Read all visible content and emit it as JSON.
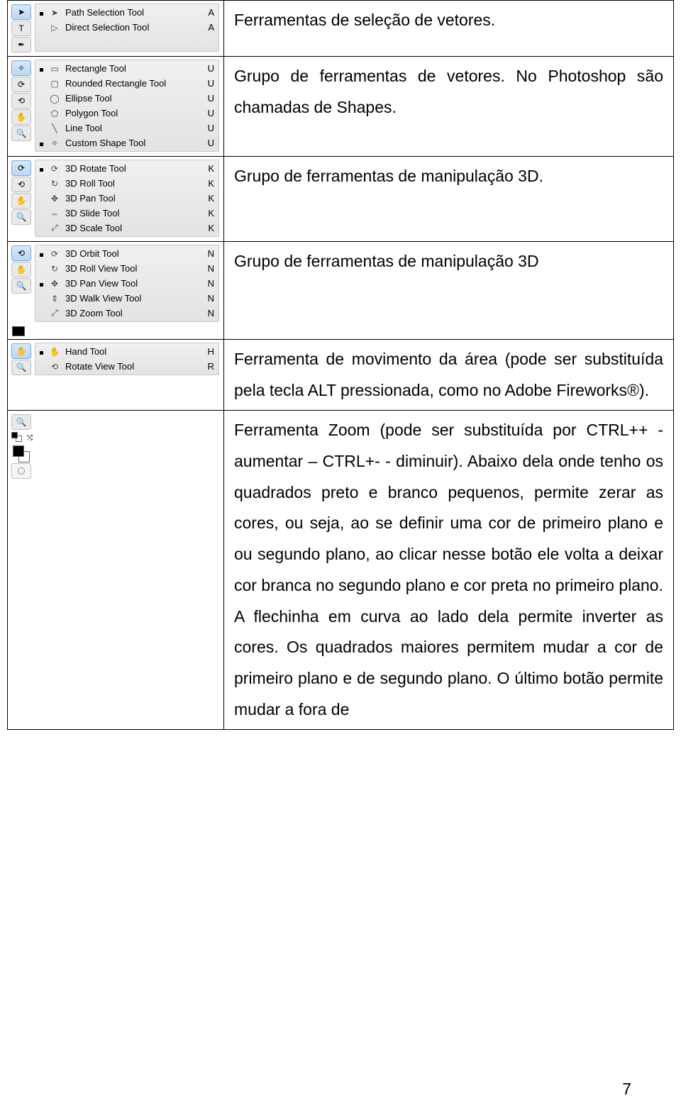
{
  "sections": {
    "s0": {
      "desc": "Ferramentas de seleção de vetores."
    },
    "s1": {
      "desc": "Grupo de ferramentas de vetores. No Photoshop são chamadas de Shapes."
    },
    "s2": {
      "desc": "Grupo de ferramentas de manipulação 3D."
    },
    "s3": {
      "desc": "Grupo de ferramentas de manipulação 3D"
    },
    "s4": {
      "desc": "Ferramenta de movimento da área (pode ser substituída pela tecla ALT pressionada, como no Adobe Fireworks®)."
    },
    "s5": {
      "desc": "Ferramenta Zoom (pode ser substituída por CTRL++ - aumentar – CTRL+- - diminuir). Abaixo dela onde tenho os quadrados preto e branco pequenos, permite zerar as cores, ou seja, ao se definir uma cor de primeiro plano e ou segundo plano, ao clicar nesse botão ele volta a deixar cor branca no segundo plano e cor preta no primeiro plano. A flechinha em curva ao lado dela permite inverter as cores.\nOs quadrados maiores permitem mudar a cor de primeiro plano e de segundo plano. O último botão permite mudar a fora de"
    }
  },
  "flyouts": {
    "path": [
      {
        "dot": true,
        "icon": "cursor-black-icon",
        "glyph": "➤",
        "label": "Path Selection Tool",
        "key": "A"
      },
      {
        "dot": false,
        "icon": "cursor-white-icon",
        "glyph": "▷",
        "label": "Direct Selection Tool",
        "key": "A"
      }
    ],
    "shapes": [
      {
        "dot": true,
        "icon": "rectangle-icon",
        "glyph": "▭",
        "label": "Rectangle Tool",
        "key": "U"
      },
      {
        "dot": false,
        "icon": "rounded-rectangle-icon",
        "glyph": "▢",
        "label": "Rounded Rectangle Tool",
        "key": "U"
      },
      {
        "dot": false,
        "icon": "ellipse-icon",
        "glyph": "◯",
        "label": "Ellipse Tool",
        "key": "U"
      },
      {
        "dot": false,
        "icon": "polygon-icon",
        "glyph": "⬠",
        "label": "Polygon Tool",
        "key": "U"
      },
      {
        "dot": false,
        "icon": "line-icon",
        "glyph": "╲",
        "label": "Line Tool",
        "key": "U"
      },
      {
        "dot": true,
        "icon": "custom-shape-icon",
        "glyph": "✧",
        "label": "Custom Shape Tool",
        "key": "U"
      }
    ],
    "threed_obj": [
      {
        "dot": true,
        "icon": "3d-rotate-icon",
        "glyph": "⟳",
        "label": "3D Rotate Tool",
        "key": "K"
      },
      {
        "dot": false,
        "icon": "3d-roll-icon",
        "glyph": "↻",
        "label": "3D Roll Tool",
        "key": "K"
      },
      {
        "dot": false,
        "icon": "3d-pan-icon",
        "glyph": "✥",
        "label": "3D Pan Tool",
        "key": "K"
      },
      {
        "dot": false,
        "icon": "3d-slide-icon",
        "glyph": "⇔",
        "label": "3D Slide Tool",
        "key": "K"
      },
      {
        "dot": false,
        "icon": "3d-scale-icon",
        "glyph": "⤢",
        "label": "3D Scale Tool",
        "key": "K"
      }
    ],
    "threed_cam": [
      {
        "dot": true,
        "icon": "3d-orbit-icon",
        "glyph": "⟳",
        "label": "3D Orbit Tool",
        "key": "N"
      },
      {
        "dot": false,
        "icon": "3d-roll-view-icon",
        "glyph": "↻",
        "label": "3D Roll View Tool",
        "key": "N"
      },
      {
        "dot": true,
        "icon": "3d-pan-view-icon",
        "glyph": "✥",
        "label": "3D Pan View Tool",
        "key": "N"
      },
      {
        "dot": false,
        "icon": "3d-walk-view-icon",
        "glyph": "⇕",
        "label": "3D Walk View Tool",
        "key": "N"
      },
      {
        "dot": false,
        "icon": "3d-zoom-icon",
        "glyph": "⤢",
        "label": "3D Zoom Tool",
        "key": "N"
      }
    ],
    "hand": [
      {
        "dot": true,
        "icon": "hand-icon",
        "glyph": "✋",
        "label": "Hand Tool",
        "key": "H"
      },
      {
        "dot": false,
        "icon": "rotate-view-icon",
        "glyph": "⟲",
        "label": "Rotate View Tool",
        "key": "R"
      }
    ]
  },
  "toolbar_slots": {
    "path": [
      {
        "icon": "path-selection-icon",
        "glyph": "➤",
        "active": true
      },
      {
        "icon": "type-icon",
        "glyph": "T"
      },
      {
        "icon": "pen-icon",
        "glyph": "✒"
      }
    ],
    "shapes": [
      {
        "icon": "custom-shape-icon",
        "glyph": "✧",
        "active": true
      },
      {
        "icon": "3d-rotate-icon",
        "glyph": "⟳"
      },
      {
        "icon": "3d-orbit-icon",
        "glyph": "⟲"
      },
      {
        "icon": "hand-icon",
        "glyph": "✋"
      },
      {
        "icon": "zoom-icon",
        "glyph": "🔍"
      }
    ],
    "threed_obj": [
      {
        "icon": "3d-rotate-icon",
        "glyph": "⟳",
        "active": true
      },
      {
        "icon": "3d-orbit-icon",
        "glyph": "⟲"
      },
      {
        "icon": "hand-icon",
        "glyph": "✋"
      },
      {
        "icon": "zoom-icon",
        "glyph": "🔍"
      }
    ],
    "threed_cam": [
      {
        "icon": "3d-orbit-icon",
        "glyph": "⟲",
        "active": true
      },
      {
        "icon": "hand-icon",
        "glyph": "✋"
      },
      {
        "icon": "zoom-icon",
        "glyph": "🔍"
      }
    ],
    "hand": [
      {
        "icon": "hand-icon",
        "glyph": "✋",
        "active": true
      },
      {
        "icon": "zoom-icon",
        "glyph": "🔍"
      }
    ],
    "zoom": [
      {
        "icon": "zoom-icon",
        "glyph": "🔍"
      }
    ]
  },
  "page_number": "7"
}
